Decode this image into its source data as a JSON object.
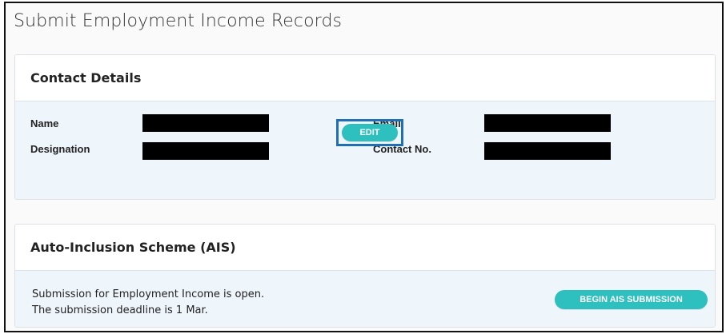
{
  "page": {
    "title": "Submit Employment Income Records"
  },
  "contact": {
    "header": "Contact Details",
    "name_label": "Name",
    "designation_label": "Designation",
    "email_label": "Email",
    "contact_label": "Contact No.",
    "edit_label": "EDIT"
  },
  "ais": {
    "header": "Auto-Inclusion Scheme (AIS)",
    "line1": "Submission for Employment Income is open.",
    "line2": "The submission deadline is 1 Mar.",
    "begin_label": "BEGIN AIS SUBMISSION"
  },
  "colors": {
    "accent_button": "#2ebfbf",
    "highlight_outline": "#1f6fb2",
    "body_tint": "#eef5fb"
  }
}
